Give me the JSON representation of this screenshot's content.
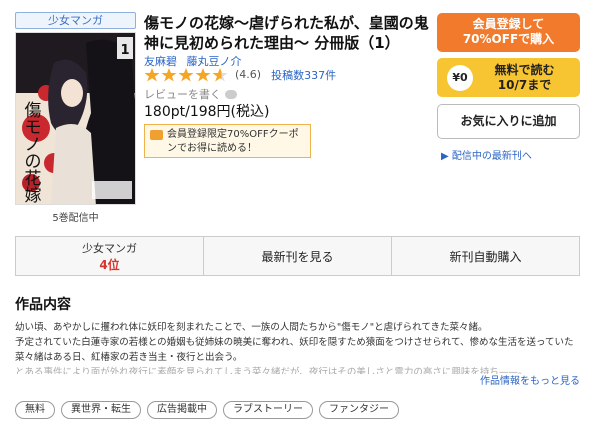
{
  "category_badge": "少女マンガ",
  "cover": {
    "volume_number": "1",
    "title_glyphs": [
      "傷",
      "モ",
      "ノ",
      "の",
      "花",
      "嫁"
    ]
  },
  "volume_status": "5巻配信中",
  "title": "傷モノの花嫁〜虐げられた私が、皇國の鬼神に見初められた理由〜 分冊版（1）",
  "authors": [
    "友麻碧",
    "藤丸豆ノ介"
  ],
  "rating": {
    "value": 4.6,
    "label": "(4.6)",
    "stars_full": 4,
    "star_fraction": 0.6,
    "review_count": "投稿数337件"
  },
  "review_link": "レビューを書く",
  "price": "180pt/198円(税込)",
  "coupon": "会員登録限定70%OFFクーポンでお得に読める！",
  "buttons": {
    "register_line1": "会員登録して",
    "register_line2": "70%OFFで購入",
    "free_icon": "¥0",
    "free_line1": "無料で読む",
    "free_line2": "10/7まで",
    "favorite": "お気に入りに追加"
  },
  "notify_link": "▶ 配信中の最新刊へ",
  "action_bar": {
    "ranking_category": "少女マンガ",
    "ranking_value": "4位",
    "latest": "最新刊を見る",
    "auto_purchase": "新刊自動購入"
  },
  "section_title": "作品内容",
  "description": {
    "line1": "幼い頃、あやかしに攫われ体に妖印を刻まれたことで、一族の人間たちから\"傷モノ\"と虐げられてきた菜々緒。",
    "line2": "予定されていた白蓮寺家の若様との婚姻も従姉妹の暁美に奪われ、妖印を隠すため猿面をつけさせられて、惨めな生活を送っていた菜々緒はある日、紅椿家の若き当主・夜行と出会う。",
    "line3": "とある事件により面が外れ夜行に素顔を見られてしまう菜々緒だが、夜行はその美しさと霊力の高さに興味を持ち——。"
  },
  "more_link": "作品情報をもっと見る",
  "tags": [
    "無料",
    "異世界・転生",
    "広告掲載中",
    "ラブストーリー",
    "ファンタジー"
  ],
  "colors": {
    "accent_orange": "#f17a2c",
    "accent_yellow": "#f7c531",
    "link_blue": "#2a64c5",
    "rank_red": "#d9342b",
    "star": "#f5a623"
  }
}
